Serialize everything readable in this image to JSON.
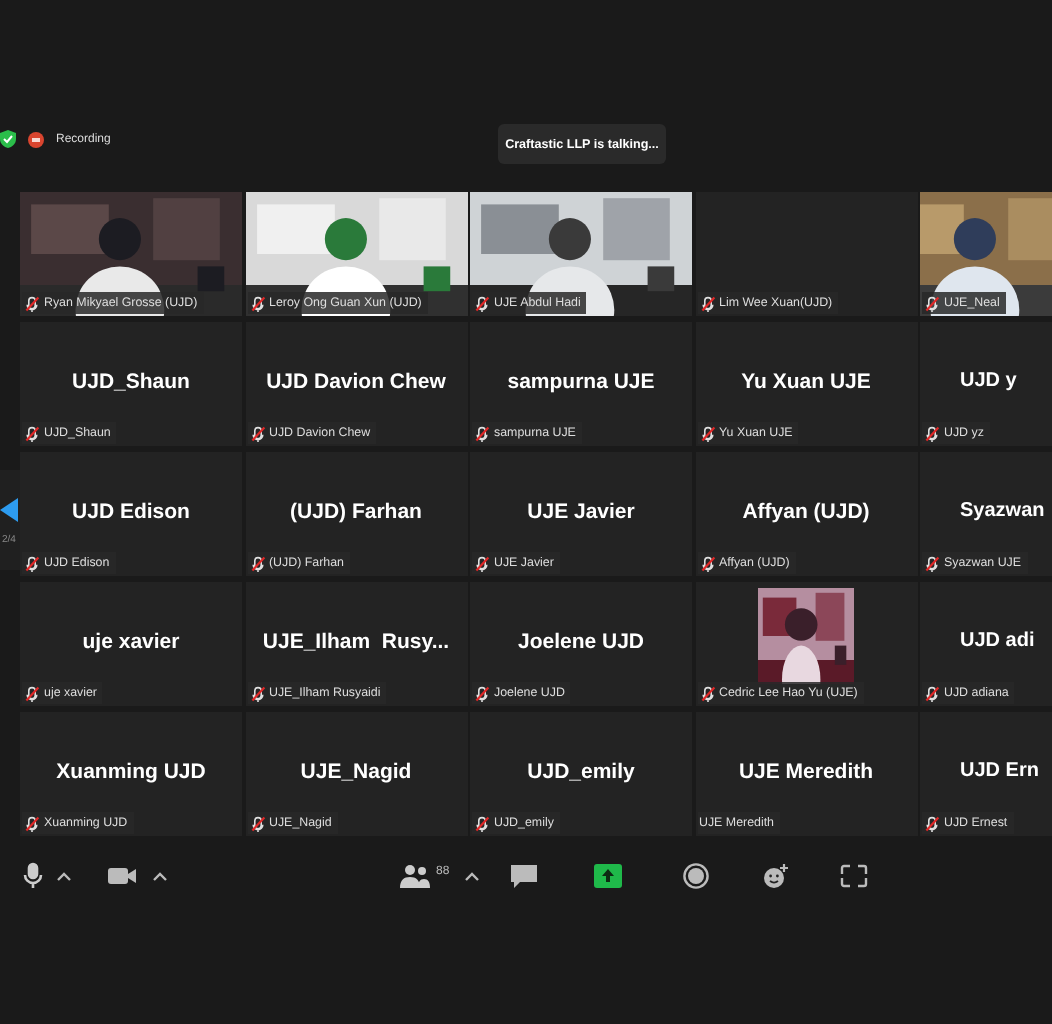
{
  "top_bar": {
    "recording_label": "Recording"
  },
  "speaker_banner": "Craftastic LLP is talking...",
  "gallery": {
    "page": "2/4",
    "tiles": [
      {
        "kind": "video",
        "label": "Ryan Mikyael Grosse (UJD)",
        "muted": true
      },
      {
        "kind": "video",
        "label": "Leroy Ong Guan Xun (UJD)",
        "muted": true
      },
      {
        "kind": "video",
        "label": "UJE Abdul Hadi",
        "muted": true
      },
      {
        "kind": "blank",
        "label": "Lim Wee Xuan(UJD)",
        "muted": true
      },
      {
        "kind": "video",
        "label": "UJE_Neal",
        "muted": true
      },
      {
        "kind": "name",
        "display_name": "UJD_Shaun",
        "label": "UJD_Shaun",
        "muted": true
      },
      {
        "kind": "name",
        "display_name": "UJD Davion Chew",
        "label": "UJD Davion Chew",
        "muted": true
      },
      {
        "kind": "name",
        "display_name": "sampurna UJE",
        "label": "sampurna UJE",
        "muted": true
      },
      {
        "kind": "name",
        "display_name": "Yu Xuan UJE",
        "label": "Yu Xuan UJE",
        "muted": true
      },
      {
        "kind": "name",
        "display_name": "UJD y",
        "label": "UJD yz",
        "muted": true
      },
      {
        "kind": "name",
        "display_name": "UJD Edison",
        "label": "UJD Edison",
        "muted": true
      },
      {
        "kind": "name",
        "display_name": "(UJD) Farhan",
        "label": "(UJD) Farhan",
        "muted": true
      },
      {
        "kind": "name",
        "display_name": "UJE Javier",
        "label": "UJE Javier",
        "muted": true
      },
      {
        "kind": "name",
        "display_name": "Affyan (UJD)",
        "label": "Affyan (UJD)",
        "muted": true
      },
      {
        "kind": "name",
        "display_name": "Syazwan",
        "label": "Syazwan UJE",
        "muted": true
      },
      {
        "kind": "name",
        "display_name": "uje xavier",
        "label": "uje xavier",
        "muted": true
      },
      {
        "kind": "name",
        "display_name": "UJE_Ilham  Rusy...",
        "label": "UJE_Ilham Rusyaidi",
        "muted": true
      },
      {
        "kind": "name",
        "display_name": "Joelene UJD",
        "label": "Joelene UJD",
        "muted": true
      },
      {
        "kind": "avatar",
        "label": "Cedric Lee Hao Yu (UJE)",
        "muted": true
      },
      {
        "kind": "name",
        "display_name": "UJD adi",
        "label": "UJD adiana",
        "muted": true
      },
      {
        "kind": "name",
        "display_name": "Xuanming UJD",
        "label": "Xuanming UJD",
        "muted": true
      },
      {
        "kind": "name",
        "display_name": "UJE_Nagid",
        "label": "UJE_Nagid",
        "muted": true
      },
      {
        "kind": "name",
        "display_name": "UJD_emily",
        "label": "UJD_emily",
        "muted": true
      },
      {
        "kind": "name",
        "display_name": "UJE Meredith",
        "label": "UJE Meredith",
        "muted": false
      },
      {
        "kind": "name",
        "display_name": "UJD Ern",
        "label": "UJD Ernest",
        "muted": true
      }
    ]
  },
  "toolbar": {
    "participant_count": "88"
  }
}
